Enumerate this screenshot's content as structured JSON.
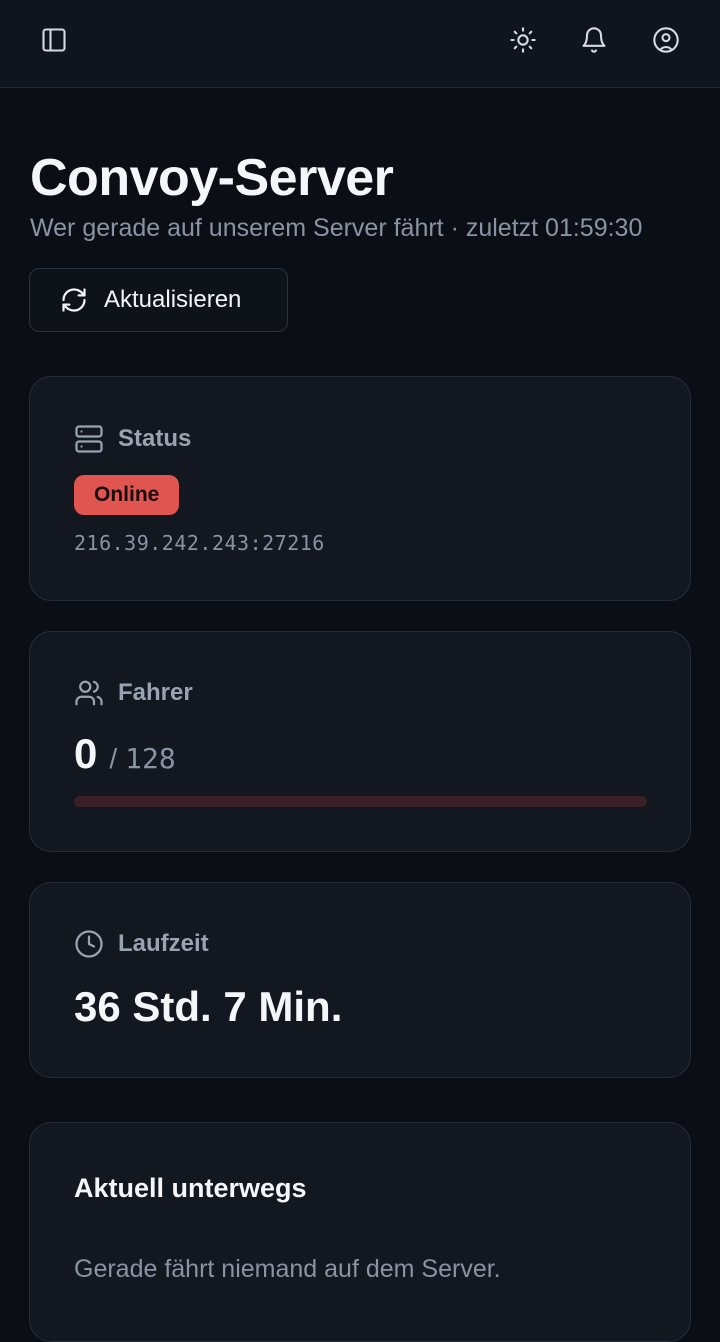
{
  "header": {
    "sidebar_toggle": "sidebar-toggle-icon",
    "theme_icon": "sun-icon",
    "notifications_icon": "bell-icon",
    "account_icon": "user-circle-icon"
  },
  "page": {
    "title": "Convoy-Server",
    "subtitle": "Wer gerade auf unserem Server fährt · zuletzt 01:59:30"
  },
  "refresh_button": {
    "label": "Aktualisieren",
    "icon": "refresh-icon"
  },
  "status_card": {
    "label": "Status",
    "icon": "server-icon",
    "badge": "Online",
    "address": "216.39.242.243:27216"
  },
  "drivers_card": {
    "label": "Fahrer",
    "icon": "users-icon",
    "current": "0",
    "separator": "/",
    "max": "128",
    "fill_fraction": 0
  },
  "uptime_card": {
    "label": "Laufzeit",
    "icon": "clock-icon",
    "value": "36 Std. 7 Min."
  },
  "active_card": {
    "title": "Aktuell unterwegs",
    "empty_text": "Gerade fährt niemand auf dem Server."
  },
  "colors": {
    "background": "#0b0e15",
    "card": "#121720",
    "accent": "#e0554f",
    "muted_text": "#8a93a3"
  }
}
